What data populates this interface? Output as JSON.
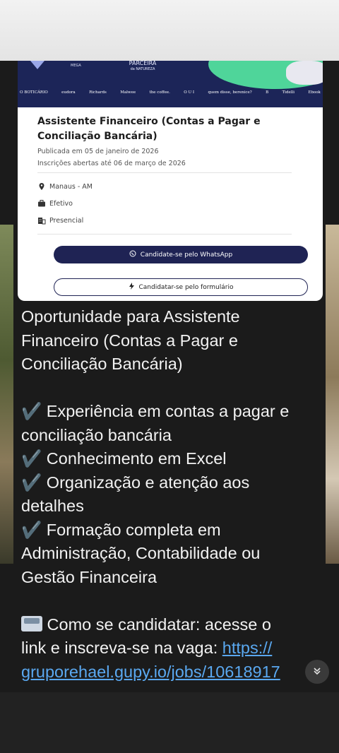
{
  "banner": {
    "small_text": "MEGA",
    "partner_title": "PARCEIRA",
    "partner_sub": "da NATUREZA",
    "brands": [
      "O BOTICÁRIO",
      "eudora",
      "Richards",
      "Malwee",
      "the coffee.",
      "O U I",
      "quem disse, berenice?",
      "B",
      "Tidelli",
      "Ebook"
    ]
  },
  "job": {
    "title": "Assistente Financeiro (Contas a Pagar e Conciliação Bancária)",
    "published": "Publicada em 05 de janeiro de 2026",
    "deadline": "Inscrições abertas até 06 de março de 2026",
    "location": "Manaus - AM",
    "contract": "Efetivo",
    "mode": "Presencial",
    "whatsapp_button": "Candidate-se pelo WhatsApp",
    "form_button": "Candidatar-se pelo formulário"
  },
  "message": {
    "intro": [
      "Oportunidade para Assistente",
      "Financeiro (Contas a Pagar e",
      "Conciliação Bancária)"
    ],
    "req1": [
      "✔️ Experiência em contas a pagar e",
      "conciliação bancária"
    ],
    "req2": "✔️ Conhecimento em Excel",
    "req3": [
      "✔️ Organização e atenção aos",
      "detalhes"
    ],
    "req4": [
      "✔️ Formação completa em",
      "Administração, Contabilidade ou",
      "Gestão Financeira"
    ],
    "apply_1": " Como se candidatar: acesse o",
    "apply_2": "link e inscreva-se na vaga: ",
    "link_1": "https://",
    "link_2": "gruporehael.gupy.io/jobs/10618917"
  },
  "icons": {
    "location": "map-pin-icon",
    "contract": "briefcase-icon",
    "mode": "building-icon",
    "whatsapp": "whatsapp-icon",
    "form": "bolt-icon",
    "scroll": "chevron-double-down-icon"
  },
  "colors": {
    "navy": "#1f2354",
    "accent_green": "#4fd59a",
    "link": "#5aa8f0"
  }
}
